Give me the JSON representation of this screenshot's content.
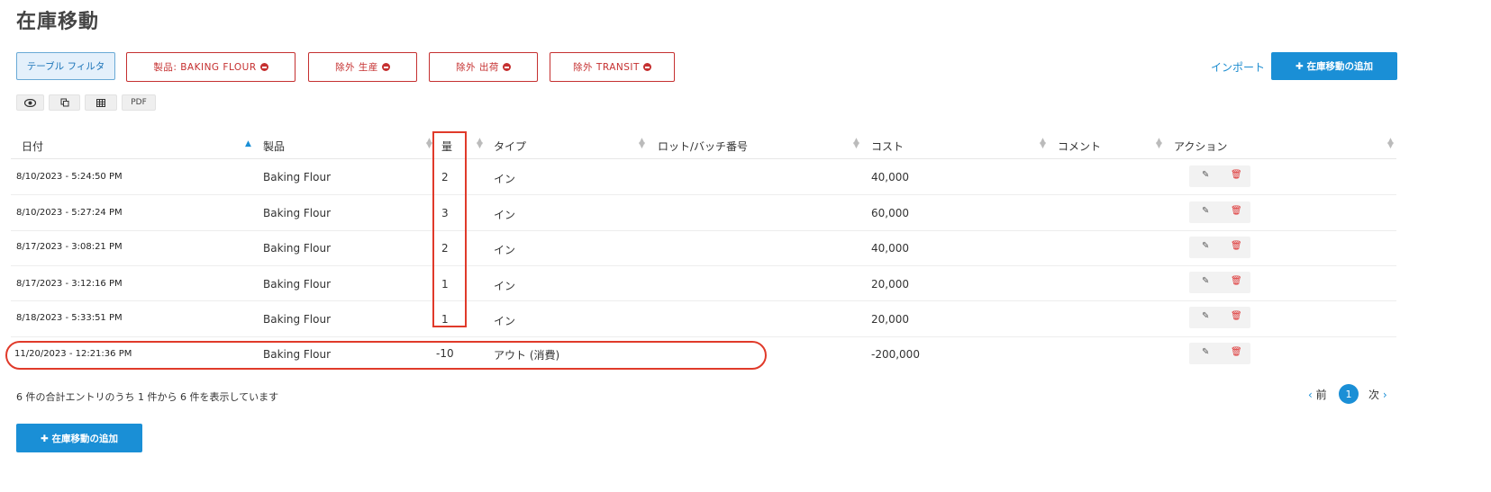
{
  "page": {
    "title": "在庫移動"
  },
  "filters": {
    "table_filter_label": "テーブル フィルタ",
    "chips": [
      {
        "label": "製品: BAKING FLOUR"
      },
      {
        "label": "除外 生産"
      },
      {
        "label": "除外 出荷"
      },
      {
        "label": "除外 TRANSIT"
      }
    ]
  },
  "toolbar": {
    "import_label": "インポート",
    "add_label": "✚ 在庫移動の追加"
  },
  "export": {
    "pdf_label": "PDF"
  },
  "table": {
    "headers": {
      "date": "日付",
      "product": "製品",
      "qty": "量",
      "type": "タイプ",
      "lot": "ロット/バッチ番号",
      "cost": "コスト",
      "comment": "コメント",
      "actions": "アクション"
    },
    "rows": [
      {
        "date": "8/10/2023 - 5:24:50 PM",
        "product": "Baking Flour",
        "qty": "2",
        "type": "イン",
        "cost": "40,000"
      },
      {
        "date": "8/10/2023 - 5:27:24 PM",
        "product": "Baking Flour",
        "qty": "3",
        "type": "イン",
        "cost": "60,000"
      },
      {
        "date": "8/17/2023 - 3:08:21 PM",
        "product": "Baking Flour",
        "qty": "2",
        "type": "イン",
        "cost": "40,000"
      },
      {
        "date": "8/17/2023 - 3:12:16 PM",
        "product": "Baking Flour",
        "qty": "1",
        "type": "イン",
        "cost": "20,000"
      },
      {
        "date": "8/18/2023 - 5:33:51 PM",
        "product": "Baking Flour",
        "qty": "1",
        "type": "イン",
        "cost": "20,000"
      },
      {
        "date": "11/20/2023 - 12:21:36 PM",
        "product": "Baking Flour",
        "qty": "-10",
        "type": "アウト (消費)",
        "cost": "-200,000"
      }
    ]
  },
  "footer": {
    "info": "6 件の合計エントリのうち 1 件から 6 件を表示しています",
    "pagination": {
      "prev": "前",
      "current": "1",
      "next": "次"
    },
    "add_label": "✚ 在庫移動の追加"
  },
  "colors": {
    "accent": "#1a8fd6",
    "danger": "#c53030",
    "annotation": "#e03a2a"
  }
}
